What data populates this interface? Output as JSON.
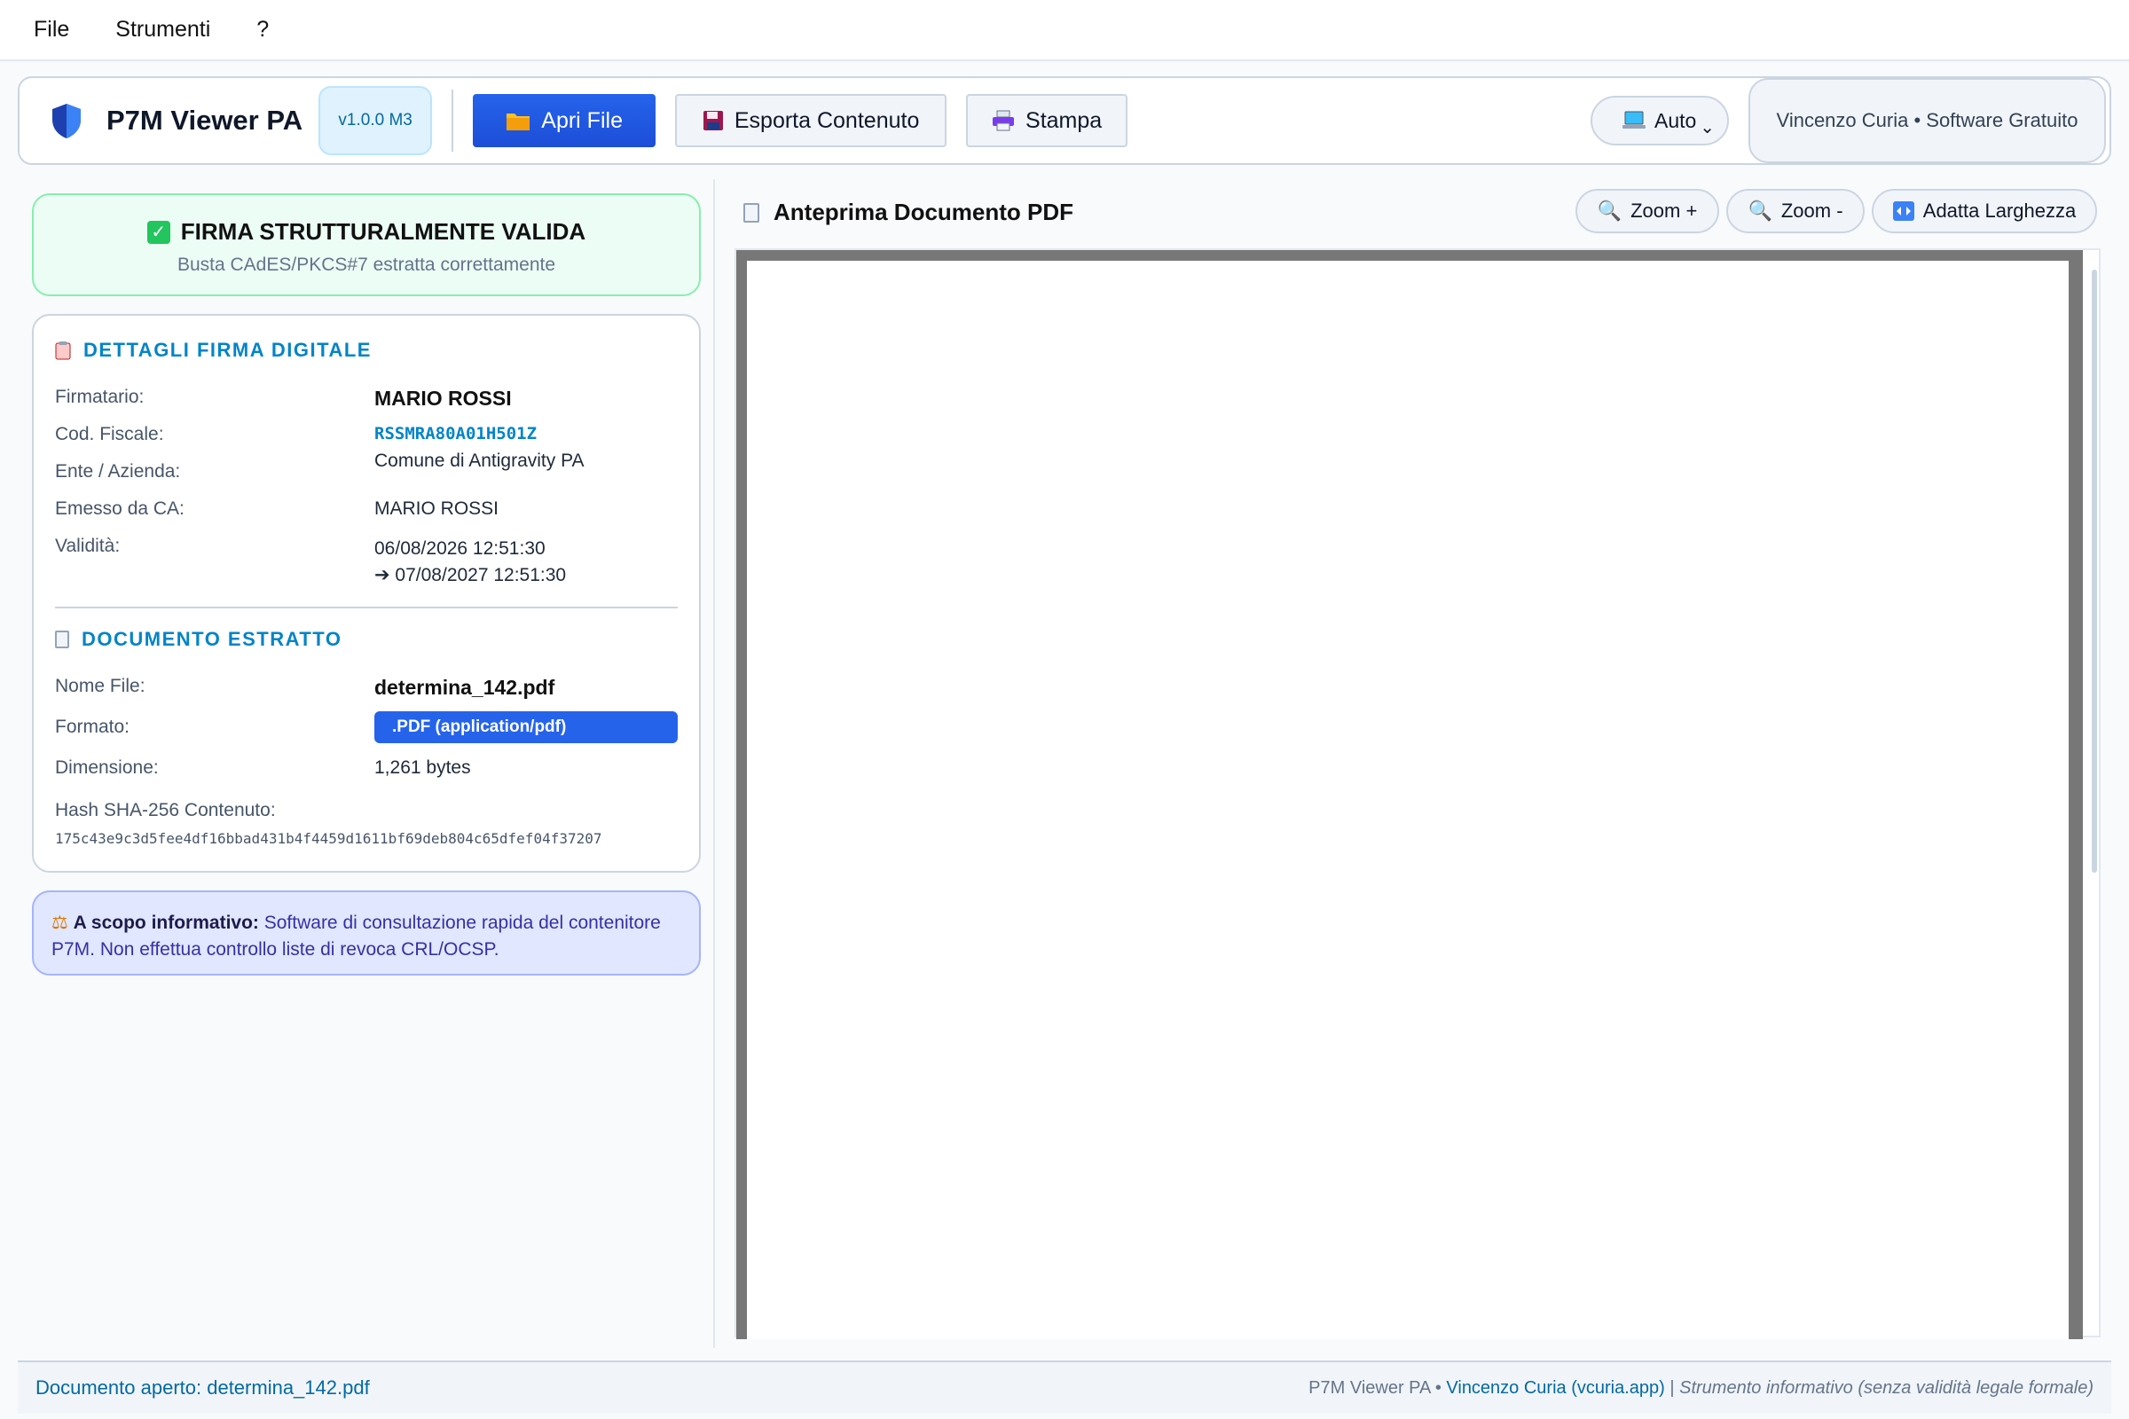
{
  "menu": {
    "items": [
      "File",
      "Strumenti",
      "?"
    ]
  },
  "toolbar": {
    "app_title": "P7M Viewer PA",
    "version": "v1.0.0 M3",
    "open_label": "Apri File",
    "export_label": "Esporta Contenuto",
    "print_label": "Stampa",
    "theme_value": "Auto",
    "author_badge": "Vincenzo Curia • Software Gratuito"
  },
  "validity": {
    "title": "FIRMA STRUTTURALMENTE VALIDA",
    "subtitle": "Busta CAdES/PKCS#7 estratta correttamente"
  },
  "signature": {
    "heading": "DETTAGLI FIRMA DIGITALE",
    "signer_label": "Firmatario:",
    "signer": "MARIO ROSSI",
    "fiscal_label": "Cod. Fiscale:",
    "fiscal_code": "RSSMRA80A01H501Z",
    "org_label": "Ente / Azienda:",
    "org": "Comune di Antigravity PA",
    "ca_label": "Emesso da CA:",
    "ca": "MARIO ROSSI",
    "validity_label": "Validità:",
    "valid_from": "06/08/2026 12:51:30",
    "valid_to": "➔ 07/08/2027 12:51:30"
  },
  "document": {
    "heading": "DOCUMENTO ESTRATTO",
    "name_label": "Nome File:",
    "name": "determina_142.pdf",
    "format_label": "Formato:",
    "format": ".PDF (application/pdf)",
    "size_label": "Dimensione:",
    "size": "1,261 bytes",
    "hash_label": "Hash SHA-256 Contenuto:",
    "hash": "175c43e9c3d5fee4df16bbad431b4f4459d1611bf69deb804c65dfef04f37207"
  },
  "info": {
    "bold": "A scopo informativo:",
    "text": " Software di consultazione rapida del contenitore P7M. Non effettua controllo liste di revoca CRL/OCSP."
  },
  "preview": {
    "title": "Anteprima Documento PDF",
    "zoom_in": "Zoom +",
    "zoom_out": "Zoom -",
    "fit_width": "Adatta Larghezza"
  },
  "status": {
    "left": "Documento aperto: determina_142.pdf",
    "app": "P7M Viewer PA • ",
    "author_link": "Vincenzo Curia (vcuria.app)",
    "sep": " | ",
    "disclaimer": "Strumento informativo (senza validità legale formale)"
  },
  "colors": {
    "primary": "#2563eb",
    "accent": "#0284c7",
    "valid_bg": "#ecfdf5",
    "info_bg": "#e0e7ff"
  }
}
